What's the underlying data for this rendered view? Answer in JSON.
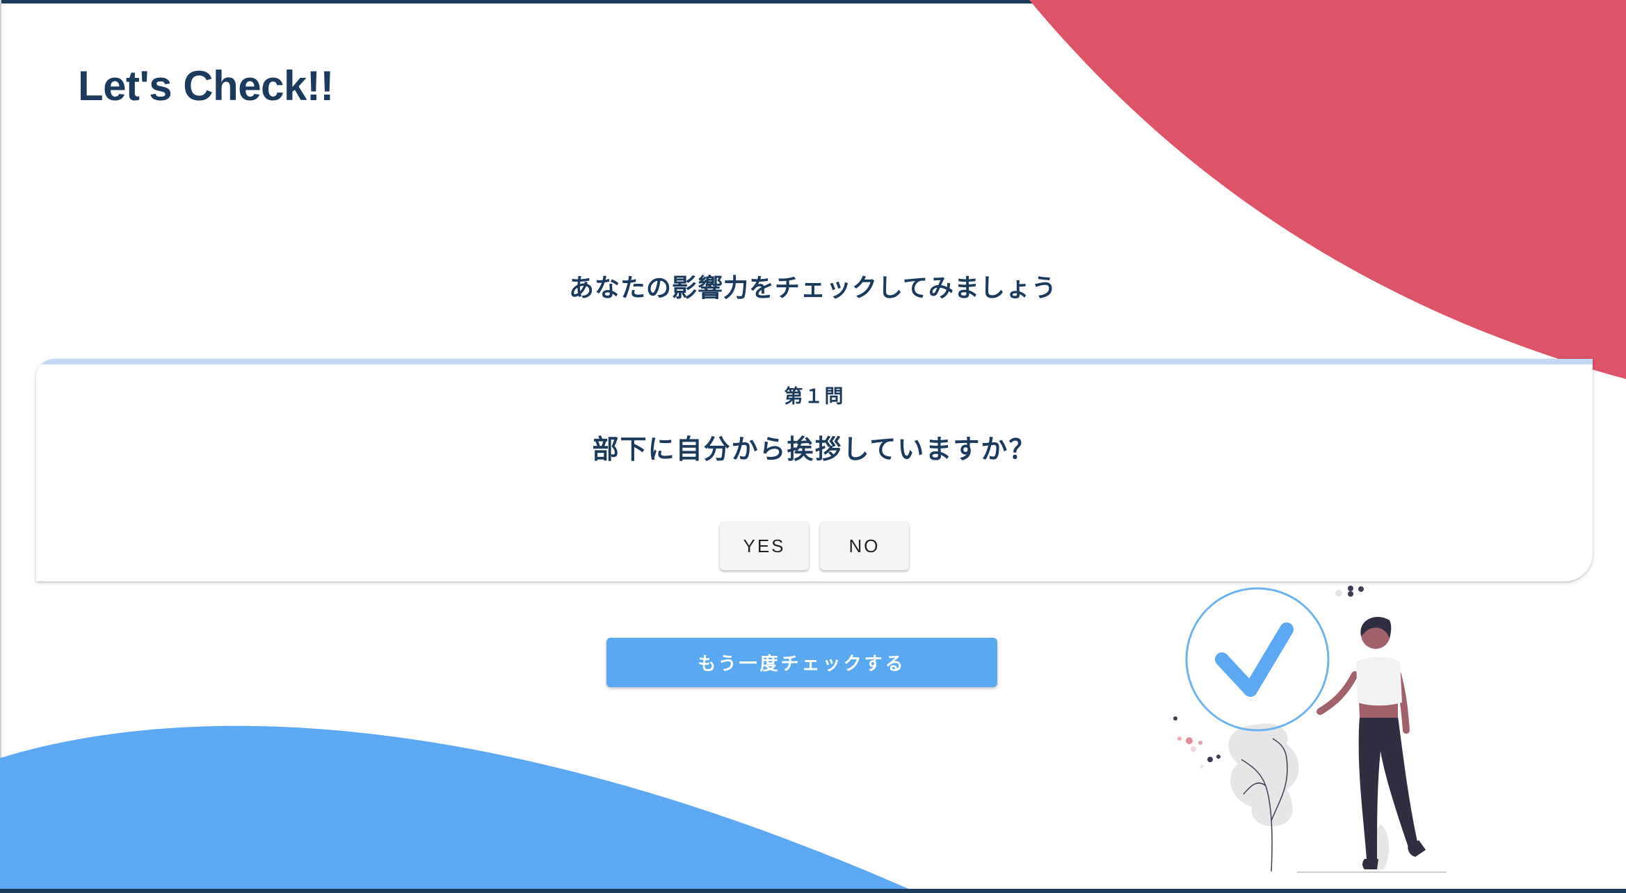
{
  "header": {
    "title": "Let's Check!!"
  },
  "intro": {
    "subtitle": "あなたの影響力をチェックしてみましょう"
  },
  "question_card": {
    "number": "第１問",
    "question": "部下に自分から挨拶していますか？",
    "yes_label": "YES",
    "no_label": "NO"
  },
  "actions": {
    "retry_label": "もう一度チェックする"
  },
  "colors": {
    "primary_text": "#1b3a5c",
    "accent_red": "#dd5367",
    "accent_blue": "#5ca8f2",
    "card_accent": "#c2d8f3"
  },
  "illustration": {
    "icon": "checkmark-person-icon"
  }
}
